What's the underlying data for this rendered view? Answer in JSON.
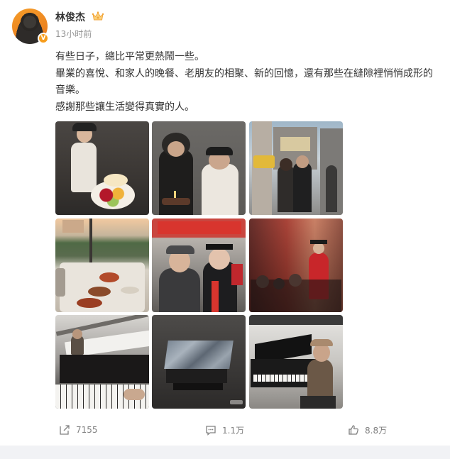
{
  "author": {
    "name": "林俊杰",
    "verified_badge": "V",
    "avatar_icon": "avatar-photo",
    "crown_icon": "crown-icon"
  },
  "post": {
    "timestamp": "13小时前",
    "lines": [
      "有些日子，總比平常更熱鬧一些。",
      "畢業的喜悅、和家人的晚餐、老朋友的相聚、新的回憶，還有那些在縫隙裡悄悄成形的音樂。",
      "感謝那些讓生活變得真實的人。"
    ],
    "images": [
      {
        "alt": "cake-photo"
      },
      {
        "alt": "birthday-photo"
      },
      {
        "alt": "street-photo"
      },
      {
        "alt": "dinner-photo"
      },
      {
        "alt": "graduation-photo"
      },
      {
        "alt": "ceremony-photo"
      },
      {
        "alt": "piano-photo"
      },
      {
        "alt": "stone-box-photo"
      },
      {
        "alt": "piano-player-photo"
      }
    ]
  },
  "actions": {
    "repost_count": "7155",
    "comment_count": "1.1万",
    "like_count": "8.8万"
  },
  "colors": {
    "accent": "#f79d1c",
    "text_primary": "#333333",
    "text_secondary": "#939393",
    "action_gray": "#808080",
    "background_strip": "#f1f2f5"
  }
}
